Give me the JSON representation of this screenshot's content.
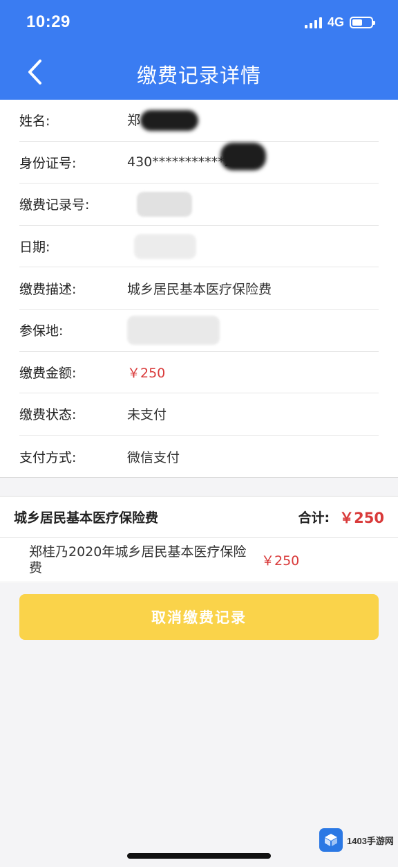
{
  "status_bar": {
    "time": "10:29",
    "network": "4G",
    "battery_level": 0.55
  },
  "nav": {
    "back_icon": "chevron-left-icon",
    "title": "缴费记录详情"
  },
  "colors": {
    "brand_blue": "#3a7cf2",
    "amount_red": "#d93a3a",
    "button_yellow": "#fad34a"
  },
  "info": {
    "rows": [
      {
        "label": "姓名:",
        "value": "郑"
      },
      {
        "label": "身份证号:",
        "value": "430***********2"
      },
      {
        "label": "缴费记录号:",
        "value": ""
      },
      {
        "label": "日期:",
        "value": ""
      },
      {
        "label": "缴费描述:",
        "value": "城乡居民基本医疗保险费"
      },
      {
        "label": "参保地:",
        "value": ""
      },
      {
        "label": "缴费金额:",
        "value": "￥250"
      },
      {
        "label": "缴费状态:",
        "value": "未支付"
      },
      {
        "label": "支付方式:",
        "value": "微信支付"
      }
    ]
  },
  "summary": {
    "title": "城乡居民基本医疗保险费",
    "total_label": "合计:",
    "total": "￥250",
    "item_name": "郑桂乃2020年城乡居民基本医疗保险费",
    "item_price": "￥250"
  },
  "actions": {
    "cancel_label": "取消缴费记录"
  },
  "watermark": {
    "text": "1403手游网"
  }
}
